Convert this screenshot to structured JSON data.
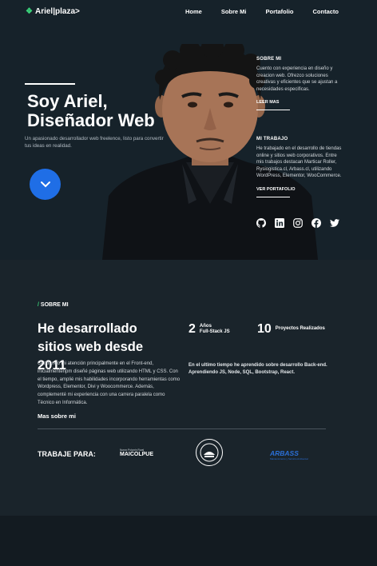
{
  "nav": {
    "logo_text": "Ariel|plaza>",
    "items": [
      "Home",
      "Sobre Mi",
      "Portafolio",
      "Contacto"
    ]
  },
  "hero": {
    "title_line1": "Soy Ariel,",
    "title_line2": "Diseñador Web",
    "subtitle": "Un apasionado desarrollador web freelence, listo para convertir tus ideas en realidad."
  },
  "side": {
    "about_heading": "SOBRE MI",
    "about_text": "Cuento con experiencia en diseño y creacion web. Ofrezco soluciones creativas y eficientes que se ajustan a necesidades especificas.",
    "about_link": "LEER MAS",
    "work_heading": "MI TRABAJO",
    "work_text": "He trabajado en el desarrollo de tiendas online y sitios web corporativos. Entre mis trabajos destacan Marticar Roller, Rysiogistica.cl, Arbass.cl, utilizando WordPress, Elementor, WooCommerce.",
    "work_link": "VER PORTAFOLIO"
  },
  "socials": [
    "github-icon",
    "linkedin-icon",
    "instagram-icon",
    "facebook-icon",
    "twitter-icon"
  ],
  "about": {
    "label_slash": "/",
    "label": "SOBRE MI",
    "title": "He desarrollado sitios web desde 2011",
    "text": "Centrando mi atención principalmente en el Front-end, inicialmentenpm diseñé páginas web utilizando HTML y CSS. Con el tiempo, amplié mis habilidades incorporando herramientas como Wordpress, Elementor, Divi y Woocommerce. Además, complementé mi experiencia con una carrera paralela como Técnico en Informática.",
    "more": "Mas sobre mi",
    "stat1_num": "2",
    "stat1_label1": "Años",
    "stat1_label2": "Full-Stack JS",
    "stat2_num": "10",
    "stat2_label": "Proyectos Realizados",
    "text2": "En el ultimo tiempo he aprendido sobre desarrollo Back-end. Aprendiendo JS, Node, SQL, Bootstrap, React.",
    "worked_for": "TRABAJE PARA:",
    "client1_small": "Nuevo Polvorin Rural",
    "client1_big": "MAICOLPUE",
    "client3_big": "ARBASS",
    "client3_small": "Mantenimiento y Servicio Ambiental"
  },
  "colors": {
    "accent_green": "#3ad27a",
    "button_blue": "#1f6ee6",
    "bg_dark": "#16222a",
    "arbass_blue": "#2b6fd6"
  }
}
